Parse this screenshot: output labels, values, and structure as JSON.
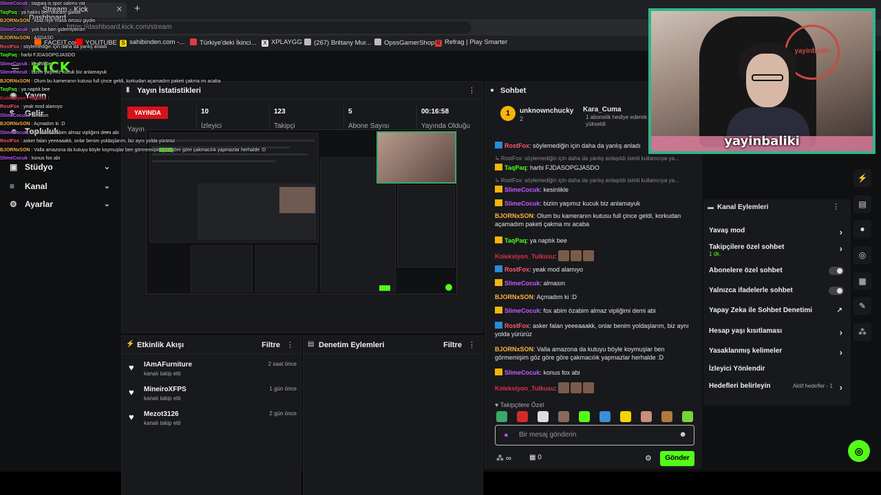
{
  "browser": {
    "tab_title": "Stream - Kick Dashboard",
    "address": "https://dashboard.kick.com/stream",
    "bookmarks": [
      "FACEIT.com",
      "YOUTUBE",
      "sahibinden.com -...",
      "Türkiye'deki İkinci...",
      "XPLAYGG",
      "(267) Brittany Mur...",
      "OpssGamerShop",
      "Refrag | Play Smarter"
    ]
  },
  "brand": "KICK",
  "sidebar": {
    "items": [
      {
        "label": "Yayın",
        "icon": "broadcast-icon"
      },
      {
        "label": "Gelir",
        "icon": "dollar-icon"
      },
      {
        "label": "Topluluk",
        "icon": "people-icon"
      },
      {
        "label": "Stüdyo",
        "icon": "studio-icon"
      },
      {
        "label": "Kanal",
        "icon": "list-icon"
      },
      {
        "label": "Ayarlar",
        "icon": "gear-icon"
      }
    ]
  },
  "stats": {
    "title": "Yayın İstatistikleri",
    "live_badge": "YAYINDA",
    "live_label": "Yayın",
    "viewers": {
      "value": "10",
      "label": "İzleyici"
    },
    "followers": {
      "value": "123",
      "label": "Takipçi"
    },
    "subs": {
      "value": "5",
      "label": "Abone Sayısı"
    },
    "uptime": {
      "value": "00:16:58",
      "label": "Yayında Olduğu Süre"
    }
  },
  "activity": {
    "title": "Etkinlik Akışı",
    "filter": "Filtre",
    "items": [
      {
        "name": "IAmAFurniture",
        "sub": "kanalı takip etti",
        "time": "2 saat önce"
      },
      {
        "name": "MineiroXFPS",
        "sub": "kanalı takip etti",
        "time": "1 gün önce"
      },
      {
        "name": "Mezot3126",
        "sub": "kanalı takip etti",
        "time": "2 gün önce"
      }
    ]
  },
  "moderation": {
    "title": "Denetim Eylemleri",
    "filter": "Filtre"
  },
  "chat": {
    "title": "Sohbet",
    "pinned_name": "unknownchucky",
    "pinned_count": "2",
    "gifter_name": "Kara_Cuma",
    "gifter_sub": "1 abonelik hediye ederek yükseldi",
    "messages": [
      {
        "user": "RostFox",
        "color": "#ff5b6e",
        "text": "söylemediğin için daha da yanlış anladı",
        "badge": "mod"
      },
      {
        "reply": "RostFox: söylemediğin için daha da yanlış anlaşıldı isimli kullanıcıya ya..."
      },
      {
        "user": "TaqPaq",
        "color": "#53fc18",
        "text": "harbi FJDASOPGJASDO",
        "badge": "crown"
      },
      {
        "reply": "RostFox: söylemediğin için daha da yanlış anlaşıldı isimli kullanıcıya ya..."
      },
      {
        "user": "SlimeCocuk",
        "color": "#c45bff",
        "text": "kesinlikle",
        "badge": "crown"
      },
      {
        "user": "SlimeCocuk",
        "color": "#c45bff",
        "text": "bizim yaşımız kucuk biz anlamayuk",
        "badge": "crown"
      },
      {
        "user": "BJORNxSON",
        "color": "#ffb347",
        "text": "Olum bu kameranın kutusu full çince geldi, korkudan açamadım paketi çakma mı acaba",
        "badge": ""
      },
      {
        "user": "TaqPaq",
        "color": "#53fc18",
        "text": "ya naptık bee",
        "badge": "crown"
      },
      {
        "user": "Koleksiyon_Tulkusu",
        "color": "#e0304a",
        "text": "",
        "badge": "",
        "emotes": 3
      },
      {
        "user": "RostFox",
        "color": "#ff5b6e",
        "text": "yeak mod alamıyo",
        "badge": "mod"
      },
      {
        "user": "SlimeCocuk",
        "color": "#c45bff",
        "text": "almasın",
        "badge": "crown"
      },
      {
        "user": "BJORNxSON",
        "color": "#ffb347",
        "text": "Açmadım ki :D",
        "badge": ""
      },
      {
        "user": "SlimeCocuk",
        "color": "#c45bff",
        "text": "fox abim özabim almaz vipliğimi demi abi",
        "badge": "crown"
      },
      {
        "user": "RostFox",
        "color": "#ff5b6e",
        "text": "asker falan yeeeaaakk, onlar benim yoldaşlarım, biz aynı yolda yürürüz",
        "badge": "mod"
      },
      {
        "user": "BJORNxSON",
        "color": "#ffb347",
        "text": "Valla amazona da kutuyu böyle koymuşlar ben görmemişim göz göre göre çakmacılık yapmazlar herhalde :D",
        "badge": ""
      },
      {
        "user": "SlimeCocuk",
        "color": "#c45bff",
        "text": "konus fox abi",
        "badge": "crown"
      },
      {
        "user": "Koleksiyon_Tulkusu",
        "color": "#e0304a",
        "text": "",
        "badge": "",
        "emotes": 3
      }
    ],
    "sub_only_label": "Takipçilere Özel",
    "input_placeholder": "Bir mesaj gönderin",
    "points": "0",
    "send_label": "Gönder"
  },
  "channel_actions": {
    "title": "Kanal Eylemleri",
    "items": [
      {
        "label": "Yavaş mod",
        "kind": "arrow"
      },
      {
        "label": "Takipçilere özel sohbet",
        "sub": "1 dk.",
        "kind": "arrow"
      },
      {
        "label": "Abonelere özel sohbet",
        "kind": "toggle"
      },
      {
        "label": "Yalnızca ifadelerle sohbet",
        "kind": "toggle"
      },
      {
        "label": "Yapay Zeka ile Sohbet Denetimi",
        "kind": "external"
      },
      {
        "label": "Hesap yaşı kısıtlaması",
        "kind": "arrow"
      },
      {
        "label": "Yasaklanmış kelimeler",
        "kind": "arrow"
      },
      {
        "label": "İzleyici Yönlendir",
        "kind": "none"
      },
      {
        "label": "Hedefleri belirleyin",
        "sub_right": "Aktif hedefler - 1",
        "kind": "arrow"
      }
    ]
  },
  "webcam": {
    "name": "yayinbaliki",
    "sign": "yayinbaliki"
  },
  "overlay_chat": [
    {
      "user": "SlimeCocuk",
      "color": "#c45bff",
      "text": "taqpaq is spor salonu var"
    },
    {
      "user": "TaqPaq",
      "color": "#53fc18",
      "text": "ya haklıs ben olucam galiba"
    },
    {
      "user": "BJORNxSON",
      "color": "#ffb347",
      "text": "Abla niye masa örtüsü giydin"
    },
    {
      "user": "SlimeCocuk",
      "color": "#c45bff",
      "text": "yok fox ben gidemiyorum"
    },
    {
      "user": "BJORNxSON",
      "color": "#ffb347",
      "text": "ASDASD"
    },
    {
      "user": "RostFox",
      "color": "#ff5b6e",
      "text": "söylemediğin için daha da yanlış anladı"
    },
    {
      "user": "TaqPaq",
      "color": "#53fc18",
      "text": "harbi FJDASOPGJASDO"
    },
    {
      "user": "SlimeCocuk",
      "color": "#c45bff",
      "text": "kesinlikle"
    },
    {
      "user": "SlimeCocuk",
      "color": "#c45bff",
      "text": "bizim yaşımız kucuk biz anlamayuk"
    },
    {
      "user": "BJORNxSON",
      "color": "#ffb347",
      "text": "Olum bu kameranın kutusu full çince geldi, korkudan açamadım paketi çakma mı acaba"
    },
    {
      "user": "TaqPaq",
      "color": "#53fc18",
      "text": "ya naptık bee"
    },
    {
      "user": "Koleksiyon_Tulkusu",
      "color": "#e0304a",
      "text": ""
    },
    {
      "user": "RostFox",
      "color": "#ff5b6e",
      "text": "yeak mod alamıyo"
    },
    {
      "user": "SlimeCocuk",
      "color": "#c45bff",
      "text": "almasın"
    },
    {
      "user": "BJORNxSON",
      "color": "#ffb347",
      "text": "Açmadım ki :D"
    },
    {
      "user": "SlimeCocuk",
      "color": "#c45bff",
      "text": "fox abim özabim almaz vipliğimi demi abi"
    },
    {
      "user": "RostFox",
      "color": "#ff5b6e",
      "text": "asker falan yeeeaaakk, onlar benim yoldaşlarım, biz aynı yolda yürürüz"
    },
    {
      "user": "BJORNxSON",
      "color": "#ffb347",
      "text": "Valla amazona da kutuyu böyle koymuşlar ben görmemişim göz göre göre çakmacılık yapmazlar herhalde :D"
    },
    {
      "user": "SlimeCocuk",
      "color": "#c45bff",
      "text": "konus fox abi"
    }
  ],
  "colors": {
    "accent": "#53fc18",
    "live": "#d6131b",
    "background": "#0f1012",
    "panel": "#18191c"
  }
}
